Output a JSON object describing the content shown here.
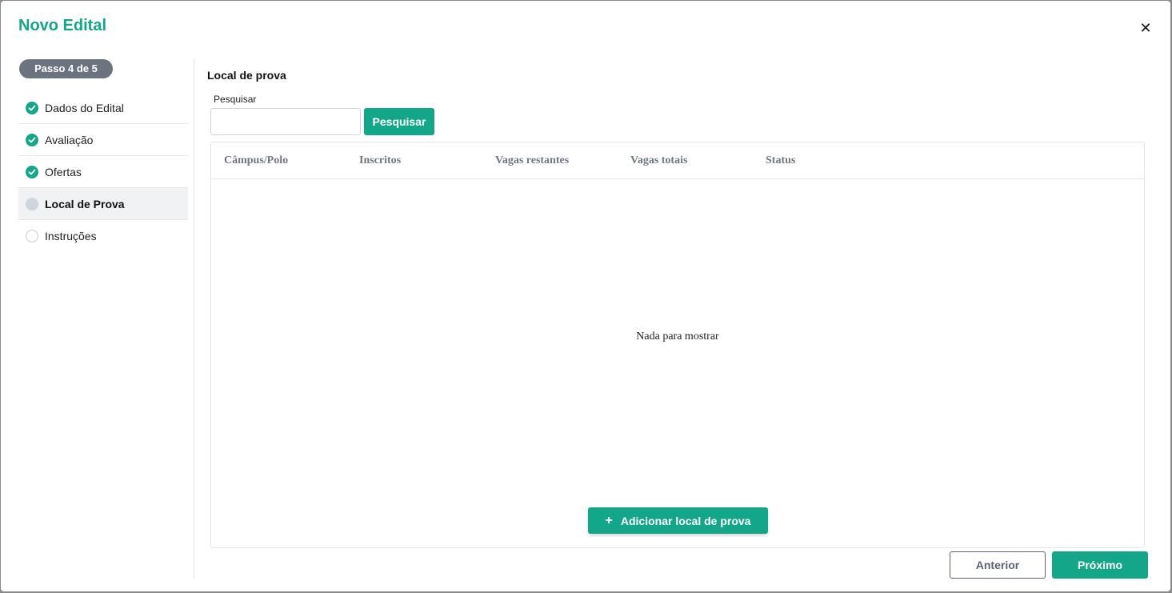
{
  "window": {
    "title": "Novo Edital",
    "close_icon": "close-icon"
  },
  "stepper": {
    "badge": "Passo 4 de 5",
    "steps": [
      {
        "label": "Dados do Edital",
        "state": "done"
      },
      {
        "label": "Avaliação",
        "state": "done"
      },
      {
        "label": "Ofertas",
        "state": "done"
      },
      {
        "label": "Local de Prova",
        "state": "current"
      },
      {
        "label": "Instruções",
        "state": "pending"
      }
    ]
  },
  "main": {
    "section_title": "Local de prova",
    "search": {
      "label": "Pesquisar",
      "value": "",
      "placeholder": "",
      "button_label": "Pesquisar"
    },
    "table": {
      "columns": [
        "Câmpus/Polo",
        "Inscritos",
        "Vagas restantes",
        "Vagas totais",
        "Status"
      ],
      "rows": [],
      "empty_text": "Nada para mostrar"
    },
    "add_button": {
      "icon": "+",
      "label": "Adicionar local de prova"
    }
  },
  "footer": {
    "prev_label": "Anterior",
    "next_label": "Próximo"
  },
  "colors": {
    "accent": "#13a689",
    "badge": "#6b7280",
    "header_text": "#6e7785"
  }
}
